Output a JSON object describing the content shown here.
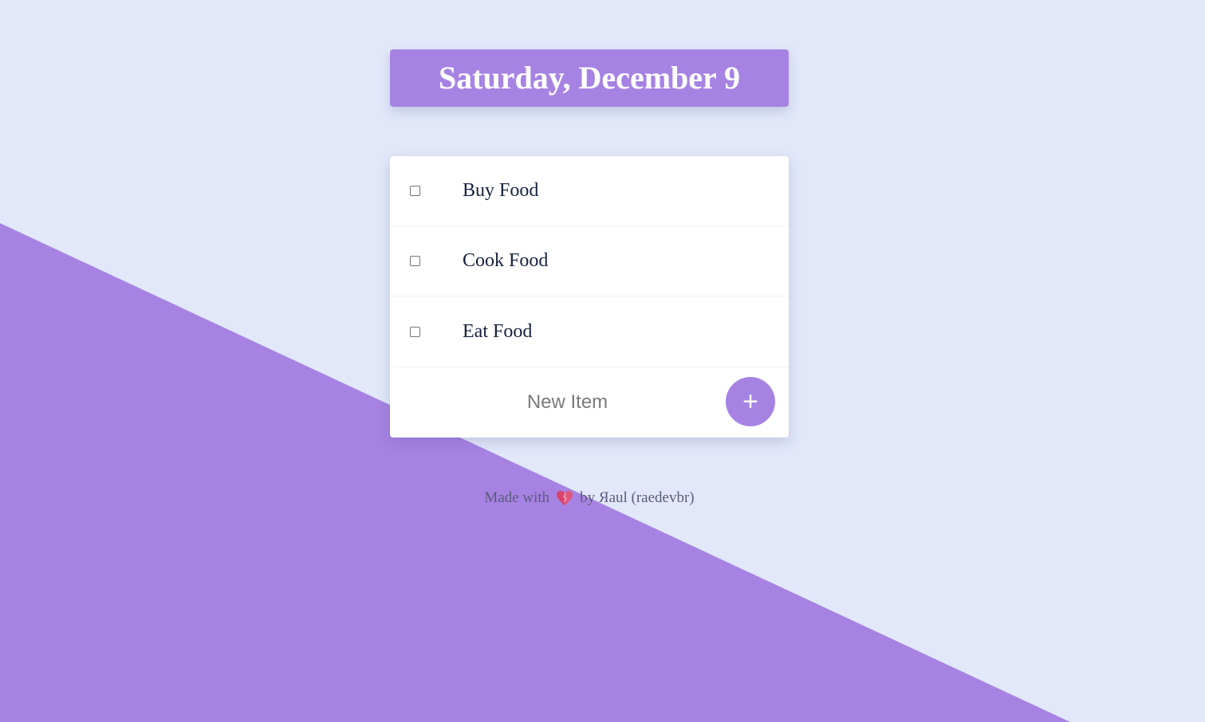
{
  "header": {
    "date": "Saturday, December 9"
  },
  "todos": [
    {
      "label": "Buy Food",
      "checked": false
    },
    {
      "label": "Cook Food",
      "checked": false
    },
    {
      "label": "Eat Food",
      "checked": false
    }
  ],
  "new_item": {
    "placeholder": "New Item",
    "add_label": "+"
  },
  "footer": {
    "prefix": "Made with",
    "icon": "heart-icon",
    "suffix": "by Яaul (raedevbr)"
  },
  "colors": {
    "background": "#E2E8FA",
    "accent": "#A683E3",
    "text": "#16213E"
  }
}
